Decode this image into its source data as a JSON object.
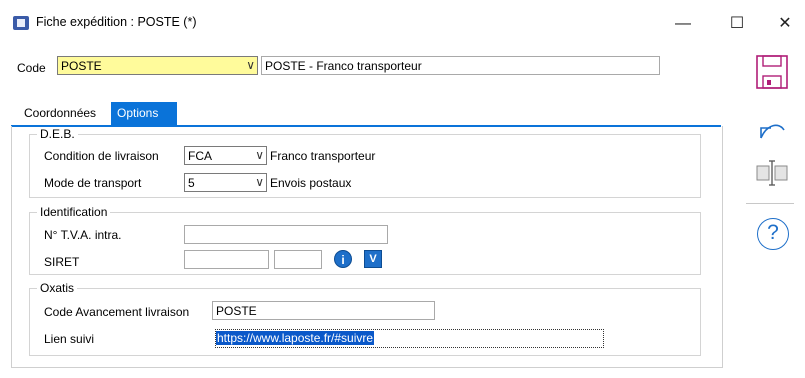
{
  "window": {
    "title": "Fiche expédition : POSTE (*)",
    "minimize_glyph": "—",
    "maximize_glyph": "☐",
    "close_glyph": "✕"
  },
  "header": {
    "code_label": "Code",
    "code_value": "POSTE",
    "code_description": "POSTE  - Franco transporteur"
  },
  "tabs": [
    {
      "label": "Coordonnées",
      "active": false
    },
    {
      "label": "Options",
      "active": true
    }
  ],
  "deb": {
    "title": "D.E.B.",
    "condition_label": "Condition de livraison",
    "condition_value": "FCA",
    "condition_text": "Franco transporteur",
    "mode_label": "Mode de transport",
    "mode_value": "5",
    "mode_text": "Envois postaux"
  },
  "identification": {
    "title": "Identification",
    "tva_label": "N° T.V.A. intra.",
    "tva_value": "",
    "siret_label": "SIRET",
    "siret_value_1": "",
    "siret_value_2": "",
    "info_glyph": "i",
    "verify_glyph": "V"
  },
  "oxatis": {
    "title": "Oxatis",
    "code_avancement_label": "Code Avancement livraison",
    "code_avancement_value": "POSTE",
    "lien_label": "Lien suivi",
    "lien_value": "https://www.laposte.fr/#suivre"
  },
  "colors": {
    "accent": "#0a73d9",
    "code_highlight": "#fffb9b",
    "sidebar_icons": "#b01e78",
    "undo_icon": "#1e6fc9"
  },
  "sidebar": {
    "icons": [
      "save-icon",
      "undo-icon",
      "column-resize-icon",
      "help-icon"
    ],
    "help_glyph": "?"
  }
}
